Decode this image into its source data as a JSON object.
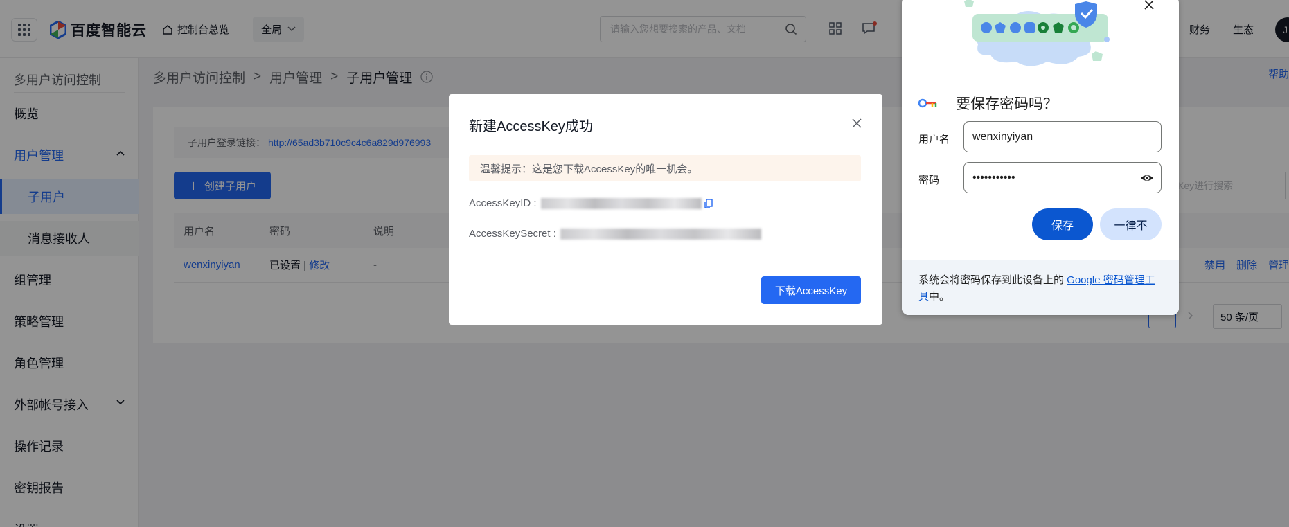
{
  "header": {
    "brand": "百度智能云",
    "home_label": "控制台总览",
    "scope_label": "全局",
    "search_placeholder": "请输入您想要搜索的产品、文档",
    "finance_label": "财务",
    "ecosystem_label": "生态",
    "avatar_initial": "J"
  },
  "sidebar": {
    "title": "多用户访问控制",
    "items": [
      {
        "label": "概览"
      },
      {
        "label": "用户管理"
      },
      {
        "label": "子用户"
      },
      {
        "label": "消息接收人"
      },
      {
        "label": "组管理"
      },
      {
        "label": "策略管理"
      },
      {
        "label": "角色管理"
      },
      {
        "label": "外部帐号接入"
      },
      {
        "label": "操作记录"
      },
      {
        "label": "密钥报告"
      },
      {
        "label": "设置"
      }
    ]
  },
  "breadcrumb": [
    "多用户访问控制",
    "用户管理",
    "子用户管理"
  ],
  "help_label": "帮助",
  "page": {
    "login_label": "子用户登录链接：",
    "login_url": "http://65ad3b710c9c4c6a829d976993",
    "create_button": "创建子用户",
    "search_placeholder": "sKey进行搜索",
    "columns": [
      "用户名",
      "密码",
      "说明"
    ],
    "row": {
      "username": "wenxinyiyan",
      "password_status": "已设置",
      "separator": "|",
      "modify": "修改",
      "description": "-",
      "actions": [
        "禁用",
        "删除",
        "管理"
      ]
    },
    "page_size": "50 条/页"
  },
  "modal": {
    "title": "新建AccessKey成功",
    "tip": "温馨提示：这是您下载AccessKey的唯一机会。",
    "ak_label": "AccessKeyID :",
    "sk_label": "AccessKeySecret :",
    "download_button": "下载AccessKey"
  },
  "password_prompt": {
    "title": "要保存密码吗？",
    "username_label": "用户名",
    "username_value": "wenxinyiyan",
    "password_label": "密码",
    "password_value": "•••••••••••",
    "save_button": "保存",
    "never_button": "一律不",
    "footer_prefix": "系统会将密码保存到此设备上的 ",
    "footer_link": "Google 密码管理工具",
    "footer_suffix": "中。"
  },
  "colors": {
    "primary": "#2468f2",
    "google_blue": "#0b57d0",
    "tip_bg": "#fdf4ec"
  }
}
